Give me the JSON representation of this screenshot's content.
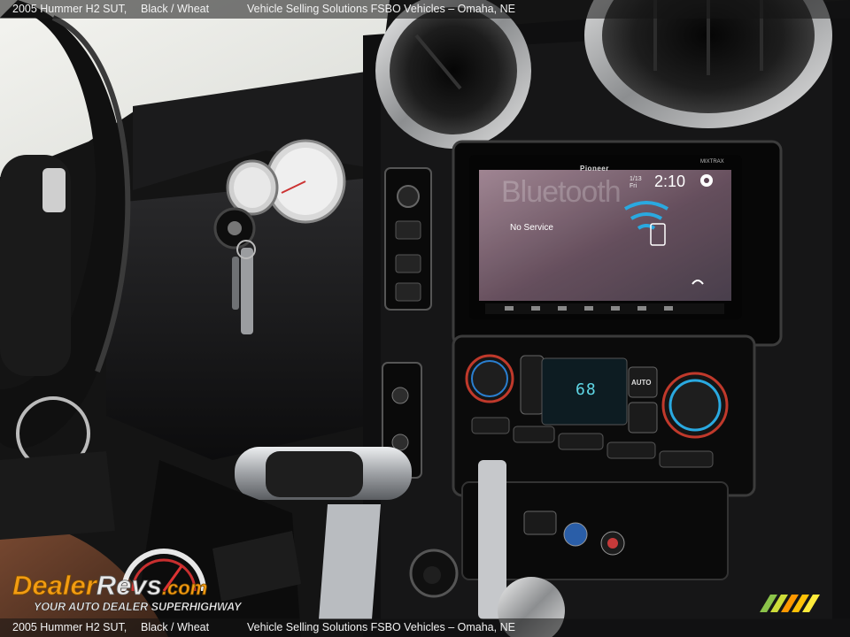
{
  "caption": {
    "title": "2005 Hummer H2 SUT,",
    "color": "Black / Wheat",
    "dealer": "Vehicle Selling Solutions FSBO Vehicles – Omaha, NE"
  },
  "watermark": {
    "brand": "DealerRevs.com",
    "tagline": "Your Auto Dealer SuperHighway"
  },
  "head_unit": {
    "brand": "Pioneer",
    "model_tag": "MIXTRAX",
    "date_line1": "1/13",
    "date_line2": "Fri",
    "time": "2:10",
    "bt_screen_text": "Bluetooth",
    "status": "No Service",
    "accent_color": "#2aa9e0"
  },
  "climate": {
    "temperature_display": "68",
    "auto_label": "AUTO"
  },
  "icons": [
    "steering-wheel-icon",
    "gear-icon",
    "wifi-icon",
    "phone-icon",
    "key-icon"
  ],
  "colors": {
    "dash": "#151515",
    "trim_silver": "#b9bcc0",
    "screen_bg": "#6b4a5a"
  }
}
